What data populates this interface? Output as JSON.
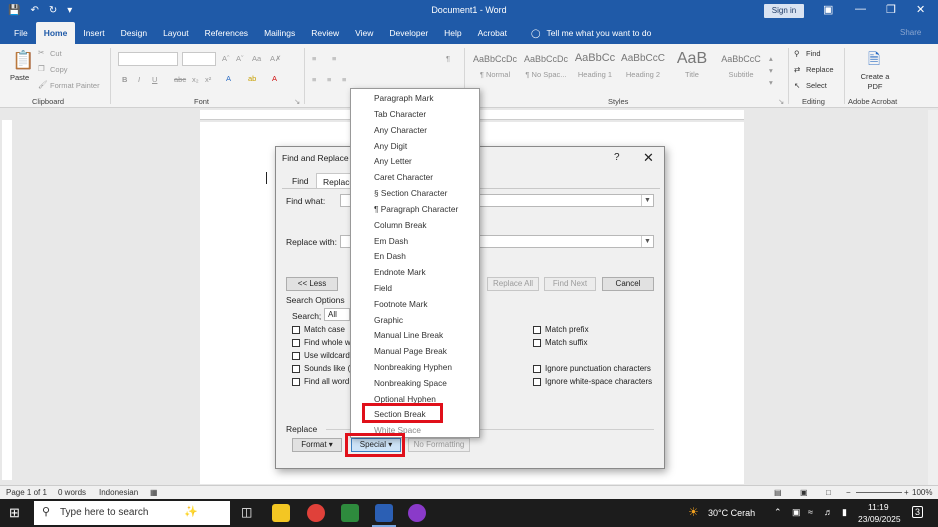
{
  "titlebar": {
    "title": "Document1  -  Word",
    "sign_in": "Sign in"
  },
  "tabs": [
    "File",
    "Home",
    "Insert",
    "Design",
    "Layout",
    "References",
    "Mailings",
    "Review",
    "View",
    "Developer",
    "Help",
    "Acrobat"
  ],
  "tell_me": "Tell me what you want to do",
  "share": "Share",
  "ribbon": {
    "clipboard": {
      "paste": "Paste",
      "cut": "Cut",
      "copy": "Copy",
      "format_painter": "Format Painter",
      "label": "Clipboard"
    },
    "font": {
      "label": "Font"
    },
    "paragraph": {
      "label": ""
    },
    "styles": {
      "label": "Styles",
      "items": [
        {
          "preview": "AaBbCcDc",
          "name": "¶ Normal"
        },
        {
          "preview": "AaBbCcDc",
          "name": "¶ No Spac..."
        },
        {
          "preview": "AaBbCc",
          "name": "Heading 1"
        },
        {
          "preview": "AaBbCcC",
          "name": "Heading 2"
        },
        {
          "preview": "AaB",
          "name": "Title"
        },
        {
          "preview": "AaBbCcC",
          "name": "Subtitle"
        }
      ]
    },
    "editing": {
      "find": "Find",
      "replace": "Replace",
      "select": "Select",
      "label": "Editing"
    },
    "acrobat": {
      "create_pdf": "Create a PDF",
      "label": "Adobe Acrobat"
    }
  },
  "dialog": {
    "title": "Find and Replace",
    "help": "?",
    "close": "✕",
    "tab_find": "Find",
    "tab_replace": "Replace",
    "find_what_label": "Find what:",
    "replace_with_label": "Replace with:",
    "less_button": "<< Less",
    "replace_all_button": "Replace All",
    "find_next_button": "Find Next",
    "cancel_button": "Cancel",
    "search_options_label": "Search Options",
    "search_label": "Search;",
    "search_value": "All",
    "options_left": [
      "Match case",
      "Find whole w",
      "Use wildcard",
      "Sounds like (",
      "Find all word"
    ],
    "options_right_top": [
      "Match prefix",
      "Match suffix"
    ],
    "options_right_bottom": [
      "Ignore punctuation characters",
      "Ignore white-space characters"
    ],
    "replace_label": "Replace",
    "format_button": "Format ▾",
    "special_button": "Special ▾",
    "no_formatting_button": "No Formatting"
  },
  "special_menu": {
    "items": [
      "Paragraph Mark",
      "Tab Character",
      "Any Character",
      "Any Digit",
      "Any Letter",
      "Caret Character",
      "§ Section Character",
      "¶ Paragraph Character",
      "Column Break",
      "Em Dash",
      "En Dash",
      "Endnote Mark",
      "Field",
      "Footnote Mark",
      "Graphic",
      "Manual Line Break",
      "Manual Page Break",
      "Nonbreaking Hyphen",
      "Nonbreaking Space",
      "Optional Hyphen",
      "Section Break",
      "White Space"
    ]
  },
  "statusbar": {
    "page": "Page 1 of 1",
    "words": "0 words",
    "language": "Indonesian",
    "zoom": "100%"
  },
  "taskbar": {
    "search_placeholder": "Type here to search",
    "weather": "30°C  Cerah",
    "time": "11:19",
    "date": "23/09/2025",
    "notif_count": "3"
  },
  "colors": {
    "word_blue": "#1f5aa8",
    "highlight_red": "#e0101a"
  }
}
